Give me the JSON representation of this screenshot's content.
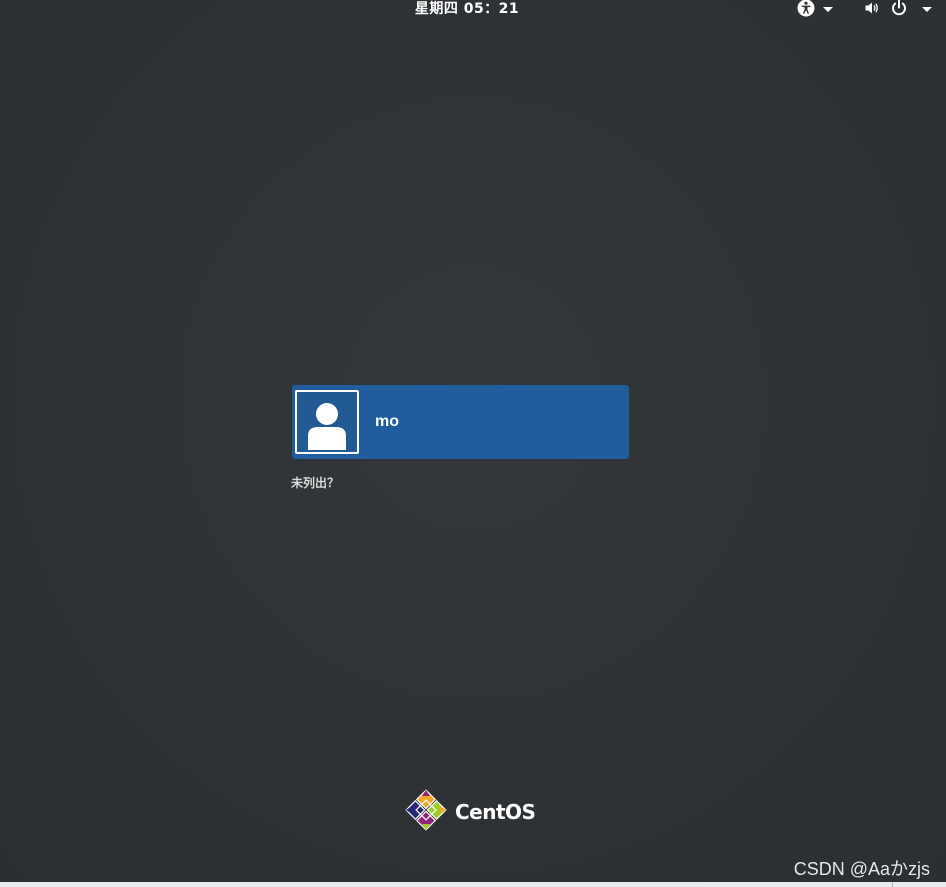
{
  "topbar": {
    "clock": "星期四 05：21",
    "accessibility_icon": "accessibility-icon",
    "volume_icon": "volume-icon",
    "power_icon": "power-icon"
  },
  "login": {
    "users": [
      {
        "name": "mo",
        "avatar_icon": "user-avatar-icon"
      }
    ],
    "not_listed_label": "未列出？"
  },
  "branding": {
    "logo_text": "CentOS",
    "logo_colors": [
      "#efa724",
      "#262577",
      "#9ccd2a",
      "#932279"
    ]
  },
  "watermark": "CSDN @Aaかzjs",
  "colors": {
    "background": "#2e3235",
    "user_card": "#215d9c",
    "text": "#ffffff"
  }
}
